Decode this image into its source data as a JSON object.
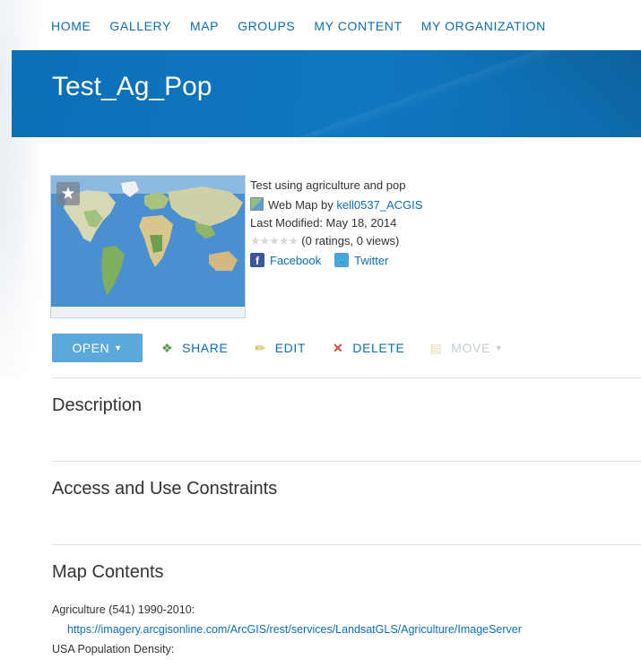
{
  "nav": [
    "HOME",
    "GALLERY",
    "MAP",
    "GROUPS",
    "MY CONTENT",
    "MY ORGANIZATION"
  ],
  "item": {
    "title": "Test_Ag_Pop",
    "snippet": "Test using agriculture and pop",
    "type_prefix": "Web Map by ",
    "owner": "kell0537_ACGIS",
    "modified": "Last Modified: May 18, 2014",
    "ratings": "(0 ratings, 0 views)",
    "rating_value": 0,
    "rating_max": 5
  },
  "social": {
    "facebook": "Facebook",
    "twitter": "Twitter"
  },
  "toolbar": {
    "open": "OPEN",
    "share": "SHARE",
    "edit": "EDIT",
    "delete": "DELETE",
    "move": "MOVE"
  },
  "sections": {
    "description": "Description",
    "access": "Access and Use Constraints",
    "contents": "Map Contents"
  },
  "map_contents": [
    {
      "name": "Agriculture (541) 1990-2010:",
      "url": "https://imagery.arcgisonline.com/ArcGIS/rest/services/LandsatGLS/Agriculture/ImageServer"
    },
    {
      "name": "USA Population Density:",
      "url": ""
    }
  ],
  "icons": {
    "favorite": "star-icon",
    "webmap": "web-map-icon",
    "share": "share-icon",
    "edit": "pencil-icon",
    "delete": "x-icon",
    "move": "folder-move-icon"
  },
  "colors": {
    "link": "#0d6eb8",
    "banner": "#0f78c1",
    "open_button": "#5aa8dc"
  }
}
